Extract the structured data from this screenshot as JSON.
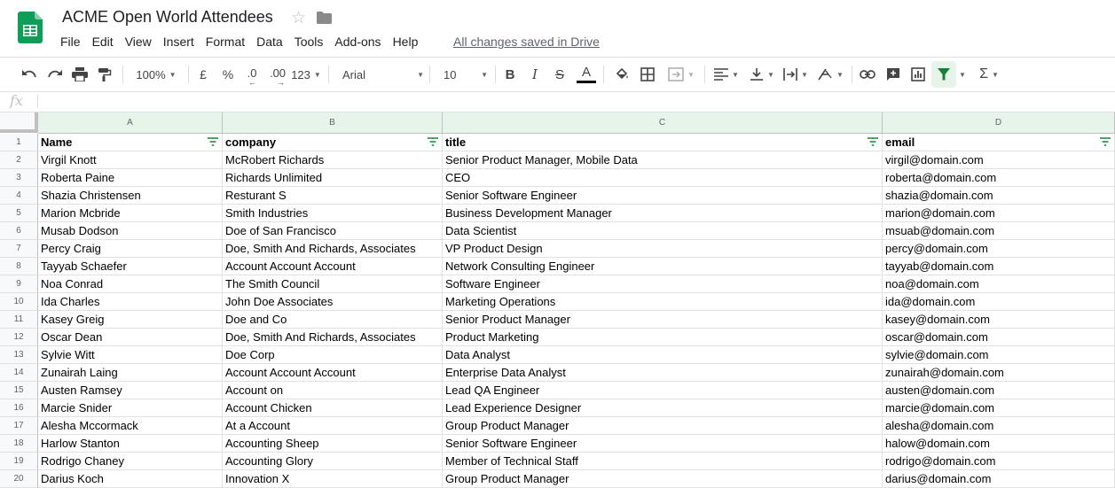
{
  "doc": {
    "title": "ACME Open World Attendees",
    "saved_status": "All changes saved in Drive"
  },
  "menu": [
    "File",
    "Edit",
    "View",
    "Insert",
    "Format",
    "Data",
    "Tools",
    "Add-ons",
    "Help"
  ],
  "toolbar": {
    "zoom": "100%",
    "currency": "£",
    "percent": "%",
    "dec_less": ".0",
    "dec_more": ".00",
    "more_formats": "123",
    "font": "Arial",
    "font_size": "10",
    "bold": "B",
    "italic": "I",
    "strike": "S",
    "text_color": "A",
    "sum": "Σ"
  },
  "formula_bar": {
    "fx": "fx",
    "value": ""
  },
  "columns": [
    "A",
    "B",
    "C",
    "D"
  ],
  "headers": [
    "Name",
    "company",
    "title",
    "email"
  ],
  "rows": [
    [
      "Virgil Knott",
      "McRobert Richards",
      "Senior Product Manager, Mobile Data",
      "virgil@domain.com"
    ],
    [
      "Roberta Paine",
      "Richards Unlimited",
      "CEO",
      "roberta@domain.com"
    ],
    [
      "Shazia Christensen",
      "Resturant S",
      "Senior Software Engineer",
      "shazia@domain.com"
    ],
    [
      "Marion Mcbride",
      "Smith Industries",
      "Business Development Manager",
      "marion@domain.com"
    ],
    [
      "Musab Dodson",
      "Doe of San Francisco",
      "Data Scientist",
      "msuab@domain.com"
    ],
    [
      "Percy Craig",
      "Doe, Smith And Richards, Associates",
      "VP Product Design",
      "percy@domain.com"
    ],
    [
      "Tayyab Schaefer",
      "Account Account Account",
      "Network Consulting Engineer",
      "tayyab@domain.com"
    ],
    [
      "Noa Conrad",
      "The Smith Council",
      "Software Engineer",
      "noa@domain.com"
    ],
    [
      "Ida Charles",
      "John Doe Associates",
      "Marketing Operations",
      "ida@domain.com"
    ],
    [
      "Kasey Greig",
      "Doe and Co",
      "Senior Product Manager",
      "kasey@domain.com"
    ],
    [
      "Oscar Dean",
      "Doe, Smith And Richards, Associates",
      "Product Marketing",
      "oscar@domain.com"
    ],
    [
      "Sylvie Witt",
      "Doe Corp",
      "Data Analyst",
      "sylvie@domain.com"
    ],
    [
      "Zunairah Laing",
      "Account Account Account",
      "Enterprise Data Analyst",
      "zunairah@domain.com"
    ],
    [
      "Austen Ramsey",
      "Account on",
      "Lead QA Engineer",
      "austen@domain.com"
    ],
    [
      "Marcie Snider",
      "Account Chicken",
      "Lead Experience Designer",
      "marcie@domain.com"
    ],
    [
      "Alesha Mccormack",
      "At a Account",
      "Group Product Manager",
      "alesha@domain.com"
    ],
    [
      "Harlow Stanton",
      "Accounting Sheep",
      "Senior Software Engineer",
      "halow@domain.com"
    ],
    [
      "Rodrigo Chaney",
      "Accounting Glory",
      "Member of Technical Staff",
      "rodrigo@domain.com"
    ],
    [
      "Darius Koch",
      "Innovation X",
      "Group Product Manager",
      "darius@domain.com"
    ]
  ],
  "row_numbers": [
    "1",
    "2",
    "3",
    "4",
    "5",
    "6",
    "7",
    "8",
    "9",
    "10",
    "11",
    "12",
    "13",
    "14",
    "15",
    "16",
    "17",
    "18",
    "19",
    "20"
  ],
  "colors": {
    "sheets_green": "#0f9d58",
    "header_highlight": "#e6f4ea",
    "filter_green": "#188038"
  }
}
